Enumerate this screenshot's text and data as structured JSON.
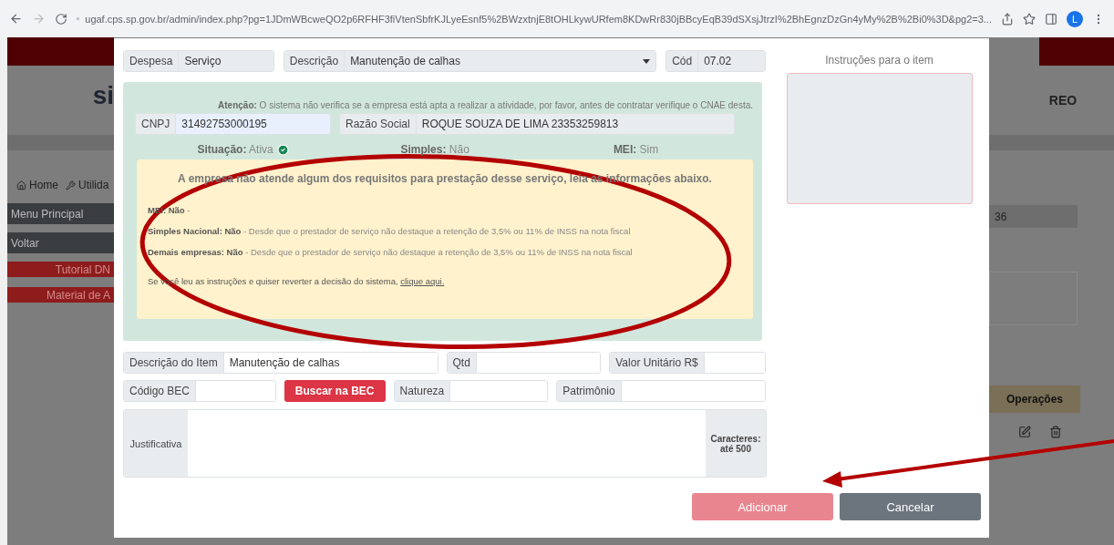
{
  "browser": {
    "url": "ugaf.cps.sp.gov.br/admin/index.php?pg=1JDmWBcweQO2p6RFHF3fiVtenSbfrKJLyeEsnf5%2BWzxtnjE8tOHLkywURfem8KDwRr830jBBcyEqB39dSXsjJtrzI%2BhEgnzDzGn4yMy%2B%2Bi0%3D&pg2=3...",
    "profile_initial": "L"
  },
  "background_page": {
    "left": {
      "brand": "si",
      "nav": [
        "Home",
        "Utilida"
      ],
      "menu": [
        {
          "label": "Menu Principal",
          "kind": "dark"
        },
        {
          "label": "Voltar",
          "kind": "dark"
        },
        {
          "label": "Tutorial DN",
          "kind": "red"
        },
        {
          "label": "Material de A",
          "kind": "red"
        }
      ]
    },
    "right": {
      "brand": "REO",
      "field_value": "36",
      "column": "Operações"
    }
  },
  "modal": {
    "expense": {
      "label": "Despesa",
      "value": "Serviço"
    },
    "description": {
      "label": "Descrição",
      "value": "Manutenção de calhas"
    },
    "code": {
      "label": "Cód",
      "value": "07.02"
    },
    "instructions": {
      "label": "Instruções para o item"
    },
    "company_check": {
      "notice": "**Atenção:** O sistema não verifica se a empresa está apta a realizar a atividade, por favor, antes de contratar verifique o CNAE desta.",
      "cnpj": {
        "label": "CNPJ",
        "value": "31492753000195"
      },
      "company_name": {
        "label": "Razão Social",
        "value": "ROQUE SOUZA DE LIMA 23353259813"
      },
      "status": [
        {
          "text": "**Situação:** Ativa",
          "verified": true
        },
        {
          "text": "**Simples:** Não",
          "verified": false
        },
        {
          "text": "**MEI:** Sim",
          "verified": false
        }
      ],
      "warning": {
        "title": "A empresa não atende algum dos requisitos para prestação desse serviço, leia as informações abaixo.",
        "lines": [
          "**MEI: Não** -",
          "**Simples Nacional: Não** - Desde que o prestador de serviço não destaque a retenção de 3,5% ou 11% de INSS na nota fiscal",
          "**Demais empresas: Não** - Desde que o prestador de serviço não destaque a retenção de 3,5% ou 11% de INSS na nota fiscal"
        ],
        "footer": "Se você leu as instruções e quiser reverter a decisão do sistema,",
        "link": "clique aqui."
      }
    },
    "item_description": {
      "label": "Descrição do Item",
      "value": "Manutenção de calhas"
    },
    "quantity": {
      "label": "Qtd"
    },
    "unit_price": {
      "label": "Valor Unitário R$"
    },
    "bec_code": {
      "label": "Código BEC"
    },
    "bec_search_button": "Buscar na BEC",
    "nature": {
      "label": "Natureza"
    },
    "asset": {
      "label": "Patrimônio"
    },
    "justification": {
      "label": "Justificativa",
      "limit": "Caracteres: até 500"
    },
    "buttons": [
      {
        "label": "Adicionar",
        "kind": "primary",
        "disabled": true
      },
      {
        "label": "Cancelar",
        "kind": "secondary",
        "disabled": false
      }
    ]
  }
}
